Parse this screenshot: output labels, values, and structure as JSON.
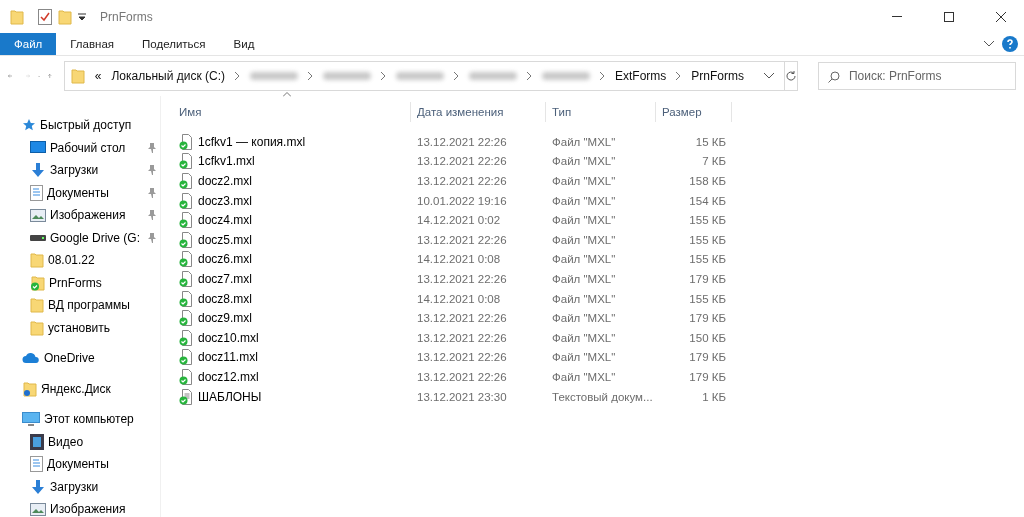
{
  "window": {
    "title": "PrnForms"
  },
  "ribbon_tabs": [
    {
      "label": "Файл",
      "selected": true
    },
    {
      "label": "Главная",
      "selected": false
    },
    {
      "label": "Поделиться",
      "selected": false
    },
    {
      "label": "Вид",
      "selected": false
    }
  ],
  "address": {
    "prefix": "«",
    "segments": [
      {
        "kind": "text",
        "label": "Локальный диск (C:)"
      },
      {
        "kind": "blurred"
      },
      {
        "kind": "blurred"
      },
      {
        "kind": "blurred"
      },
      {
        "kind": "blurred"
      },
      {
        "kind": "blurred"
      },
      {
        "kind": "text",
        "label": "ExtForms"
      },
      {
        "kind": "text",
        "label": "PrnForms"
      }
    ]
  },
  "search": {
    "placeholder": "Поиск: PrnForms"
  },
  "sidebar": {
    "sections": [
      {
        "label": "Быстрый доступ",
        "kind": "star",
        "children": [
          {
            "label": "Рабочий стол",
            "kind": "desktop",
            "pinned": true
          },
          {
            "label": "Загрузки",
            "kind": "download",
            "pinned": true
          },
          {
            "label": "Документы",
            "kind": "document",
            "pinned": true
          },
          {
            "label": "Изображения",
            "kind": "image",
            "pinned": true
          },
          {
            "label": "Google Drive (G:",
            "kind": "drive",
            "pinned": true
          },
          {
            "label": "08.01.22",
            "kind": "folder",
            "pinned": false
          },
          {
            "label": "PrnForms",
            "kind": "synced-folder",
            "pinned": false
          },
          {
            "label": "ВД программы",
            "kind": "folder",
            "pinned": false
          },
          {
            "label": "установить",
            "kind": "folder",
            "pinned": false
          }
        ]
      },
      {
        "label": "OneDrive",
        "kind": "cloud"
      },
      {
        "label": "Яндекс.Диск",
        "kind": "yandex"
      },
      {
        "label": "Этот компьютер",
        "kind": "computer",
        "children": [
          {
            "label": "Видео",
            "kind": "video",
            "pinned": false
          },
          {
            "label": "Документы",
            "kind": "document",
            "pinned": false
          },
          {
            "label": "Загрузки",
            "kind": "download",
            "pinned": false
          },
          {
            "label": "Изображения",
            "kind": "image",
            "pinned": false
          }
        ]
      }
    ]
  },
  "table": {
    "columns": [
      {
        "label": "Имя",
        "sorted": true
      },
      {
        "label": "Дата изменения",
        "sorted": false
      },
      {
        "label": "Тип",
        "sorted": false
      },
      {
        "label": "Размер",
        "sorted": false
      }
    ],
    "rows": [
      {
        "kind": "file",
        "name": "1cfkv1 — копия.mxl",
        "date": "13.12.2021 22:26",
        "type": "Файл \"MXL\"",
        "size": "15 КБ"
      },
      {
        "kind": "file",
        "name": "1cfkv1.mxl",
        "date": "13.12.2021 22:26",
        "type": "Файл \"MXL\"",
        "size": "7 КБ"
      },
      {
        "kind": "file",
        "name": "docz2.mxl",
        "date": "13.12.2021 22:26",
        "type": "Файл \"MXL\"",
        "size": "158 КБ"
      },
      {
        "kind": "file",
        "name": "docz3.mxl",
        "date": "10.01.2022 19:16",
        "type": "Файл \"MXL\"",
        "size": "154 КБ"
      },
      {
        "kind": "file",
        "name": "docz4.mxl",
        "date": "14.12.2021 0:02",
        "type": "Файл \"MXL\"",
        "size": "155 КБ"
      },
      {
        "kind": "file",
        "name": "docz5.mxl",
        "date": "13.12.2021 22:26",
        "type": "Файл \"MXL\"",
        "size": "155 КБ"
      },
      {
        "kind": "file",
        "name": "docz6.mxl",
        "date": "14.12.2021 0:08",
        "type": "Файл \"MXL\"",
        "size": "155 КБ"
      },
      {
        "kind": "file",
        "name": "docz7.mxl",
        "date": "13.12.2021 22:26",
        "type": "Файл \"MXL\"",
        "size": "179 КБ"
      },
      {
        "kind": "file",
        "name": "docz8.mxl",
        "date": "14.12.2021 0:08",
        "type": "Файл \"MXL\"",
        "size": "155 КБ"
      },
      {
        "kind": "file",
        "name": "docz9.mxl",
        "date": "13.12.2021 22:26",
        "type": "Файл \"MXL\"",
        "size": "179 КБ"
      },
      {
        "kind": "file",
        "name": "docz10.mxl",
        "date": "13.12.2021 22:26",
        "type": "Файл \"MXL\"",
        "size": "150 КБ"
      },
      {
        "kind": "file",
        "name": "docz11.mxl",
        "date": "13.12.2021 22:26",
        "type": "Файл \"MXL\"",
        "size": "179 КБ"
      },
      {
        "kind": "file",
        "name": "docz12.mxl",
        "date": "13.12.2021 22:26",
        "type": "Файл \"MXL\"",
        "size": "179 КБ"
      },
      {
        "kind": "text",
        "name": "ШАБЛОНЫ",
        "date": "13.12.2021 23:30",
        "type": "Текстовый докум...",
        "size": "1 КБ"
      }
    ]
  }
}
